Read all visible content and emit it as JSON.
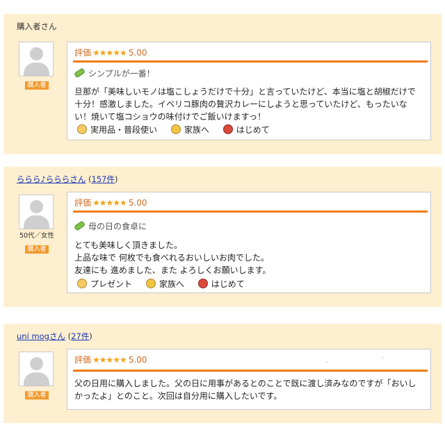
{
  "reviews": [
    {
      "reviewer": {
        "name": "購入者さん",
        "count": ""
      },
      "demographic": "",
      "badge": "購入者",
      "rating_label": "評価",
      "stars": "★★★★★",
      "score": "5.00",
      "rating_value": 5.0,
      "title": "シンプルが一番！",
      "body": "旦那が「美味しいモノは塩こしょうだけで十分」と言っていたけど、本当に塩と胡椒だけで十分！感激しました。イベリコ豚肉の贅沢カレーにしようと思っていたけど、もったいない！焼いて塩コショウの味付けでご飯いけますっ！",
      "tags": [
        {
          "icon": "hand-icon",
          "label": "実用品・普段使い"
        },
        {
          "icon": "family-icon",
          "label": "家族へ"
        },
        {
          "icon": "basket-icon",
          "label": "はじめて"
        }
      ]
    },
    {
      "reviewer": {
        "name": "ららら♪らららさん",
        "count": "157件"
      },
      "demographic": "50代／女性",
      "badge": "購入者",
      "rating_label": "評価",
      "stars": "★★★★★",
      "score": "5.00",
      "rating_value": 5.0,
      "title": "母の日の食卓に",
      "body_lines": [
        "とても美味しく頂きました。",
        "上品な味で 何枚でも食べれるおいしいお肉でした。",
        "友達にも 進めました、また よろしくお願いします。"
      ],
      "tags": [
        {
          "icon": "hand-icon",
          "label": "プレゼント"
        },
        {
          "icon": "family-icon",
          "label": "家族へ"
        },
        {
          "icon": "basket-icon",
          "label": "はじめて"
        }
      ]
    },
    {
      "reviewer": {
        "name": "uni mogさん",
        "count": "27件"
      },
      "demographic": "",
      "badge": "購入者",
      "rating_label": "評価",
      "stars": "★★★★★",
      "score": "5.00",
      "rating_value": 5.0,
      "title": "",
      "body": "父の日用に購入しました。父の日に用事があるとのことで既に渡し済みなのですが「おいしかったよ」とのこと。次回は自分用に購入したいです。",
      "tags": []
    }
  ],
  "colors": {
    "panel_bg": "#fdefcf",
    "accent_rule": "#f07a12",
    "star": "#f2a21a",
    "badge": "#f29a2e",
    "link": "#1a35b8"
  }
}
